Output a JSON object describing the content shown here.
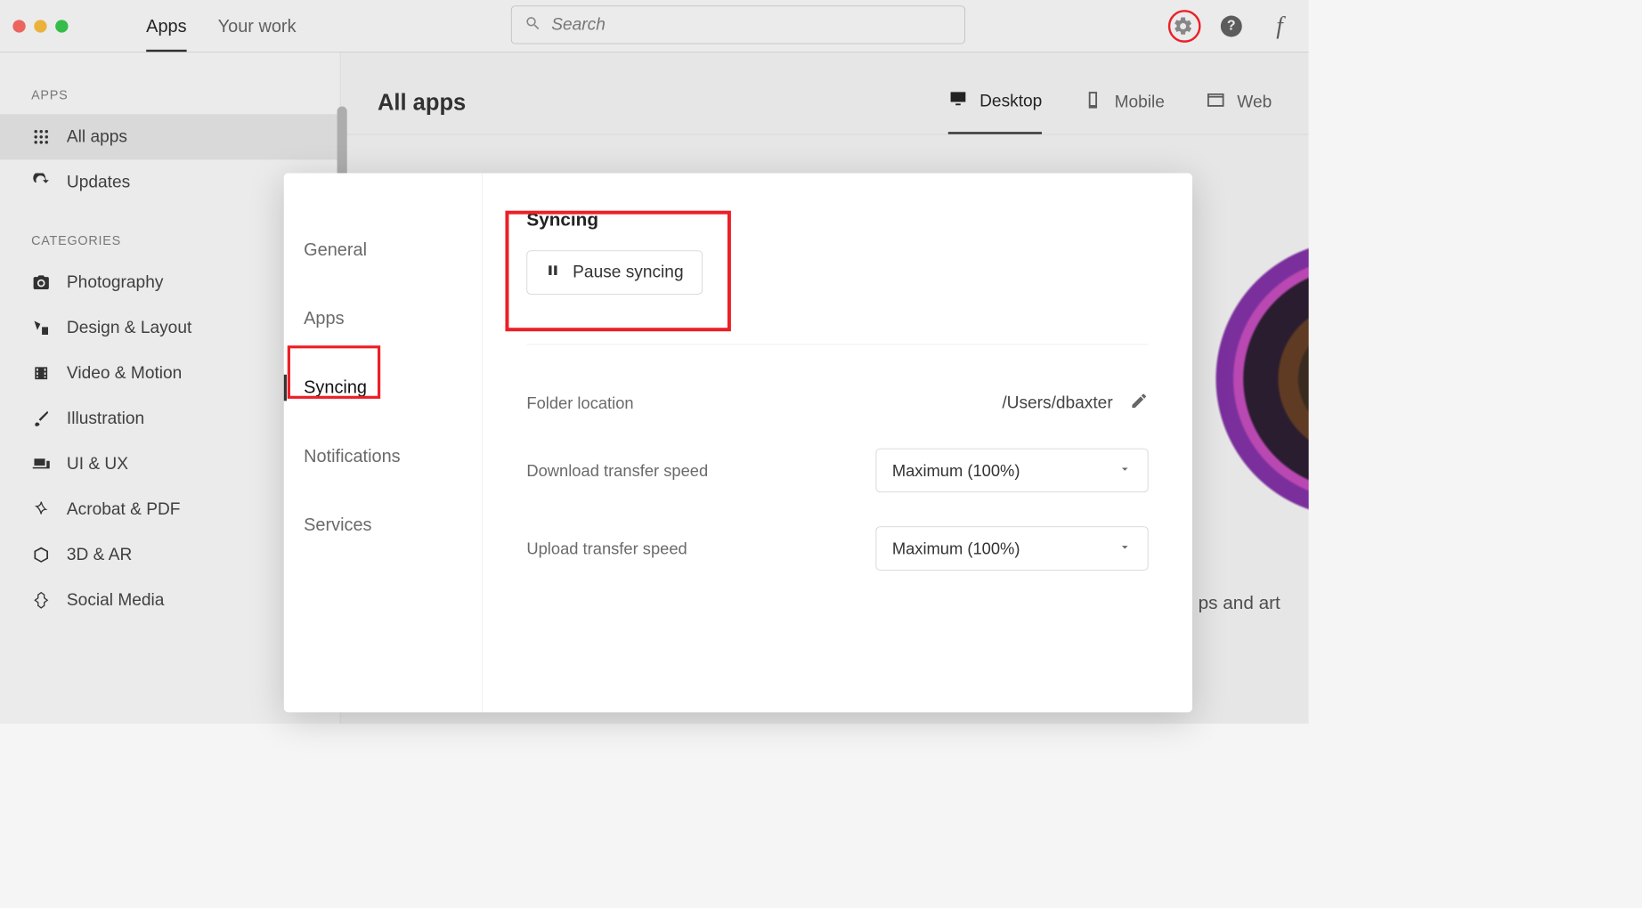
{
  "header": {
    "tabs": [
      "Apps",
      "Your work"
    ],
    "search_placeholder": "Search"
  },
  "sidebar": {
    "section_apps": "APPS",
    "items_apps": [
      {
        "label": "All apps"
      },
      {
        "label": "Updates"
      }
    ],
    "section_categories": "CATEGORIES",
    "items_categories": [
      {
        "label": "Photography"
      },
      {
        "label": "Design & Layout"
      },
      {
        "label": "Video & Motion"
      },
      {
        "label": "Illustration"
      },
      {
        "label": "UI & UX"
      },
      {
        "label": "Acrobat & PDF"
      },
      {
        "label": "3D & AR"
      },
      {
        "label": "Social Media"
      }
    ]
  },
  "main": {
    "title": "All apps",
    "platform_tabs": [
      "Desktop",
      "Mobile",
      "Web"
    ],
    "hero_caption": "ps and art"
  },
  "prefs": {
    "nav": [
      "General",
      "Apps",
      "Syncing",
      "Notifications",
      "Services"
    ],
    "syncing_title": "Syncing",
    "pause_label": "Pause syncing",
    "folder_label": "Folder location",
    "folder_value": "/Users/dbaxter",
    "download_label": "Download transfer speed",
    "download_value": "Maximum (100%)",
    "upload_label": "Upload transfer speed",
    "upload_value": "Maximum (100%)"
  }
}
